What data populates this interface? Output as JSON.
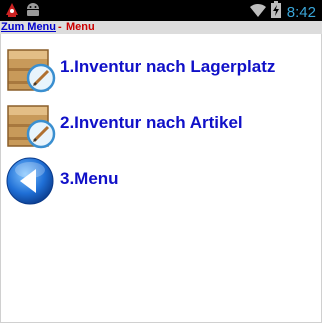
{
  "statusbar": {
    "time": "8:42",
    "icons": [
      "alert-icon",
      "android-icon",
      "wifi-icon",
      "battery-charging-icon"
    ]
  },
  "navbar": {
    "link": "Zum Menu",
    "separator": "-",
    "current": "Menu"
  },
  "menu": {
    "items": [
      {
        "label": "1.Inventur nach Lagerplatz",
        "icon": "box-edit-icon"
      },
      {
        "label": "2.Inventur nach Artikel",
        "icon": "box-edit-icon"
      },
      {
        "label": "3.Menu",
        "icon": "back-arrow-icon"
      }
    ]
  },
  "colors": {
    "link": "#0000cc",
    "current": "#cc0000",
    "item_text": "#1010c8",
    "clock": "#3aa6d8"
  }
}
